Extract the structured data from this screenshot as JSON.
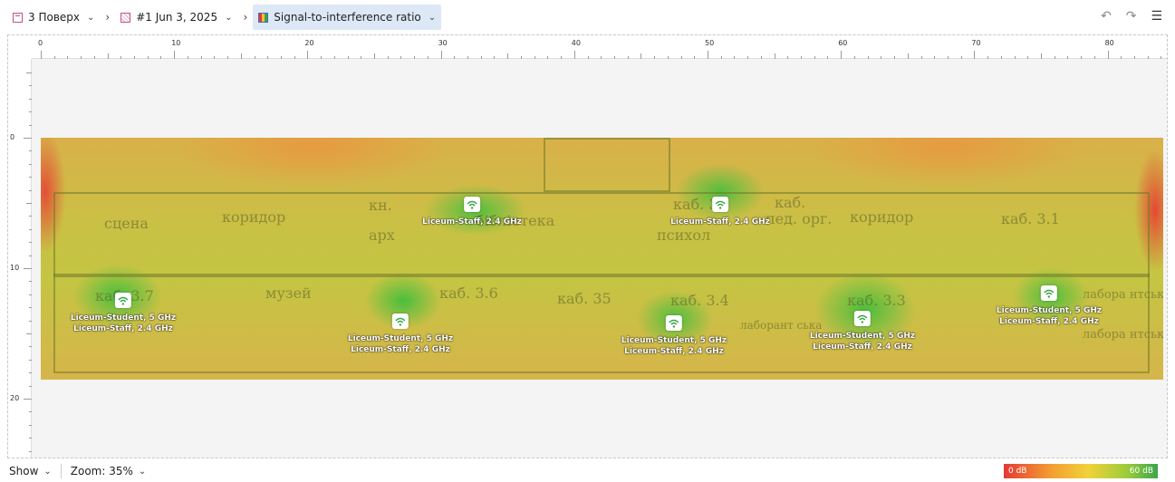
{
  "breadcrumb": {
    "floor": "3 Поверх",
    "survey": "#1 Jun 3, 2025",
    "visualization": "Signal-to-interference ratio"
  },
  "toolbar_icons": [
    "undo-icon",
    "redo-icon",
    "settings-sliders-icon"
  ],
  "ruler": {
    "top": [
      "0",
      "10",
      "20",
      "30",
      "40",
      "50",
      "60",
      "70",
      "80"
    ],
    "left": [
      "0",
      "10",
      "20"
    ],
    "units": "m"
  },
  "floor_plan": {
    "rooms": [
      "сцена",
      "коридор",
      "кн.",
      "арх",
      "бібліотека",
      "каб. 3.",
      "психол",
      "каб.",
      "пед. орг.",
      "коридор",
      "каб. 3.1",
      "каб. 3.7",
      "музей",
      "каб. 3.6",
      "каб. 35",
      "каб. 3.4",
      "лаборант ська",
      "каб. 3.3",
      "лабора нтська",
      "лабора нтська"
    ]
  },
  "access_points": [
    {
      "networks": [
        "Liceum-Student, 5 GHz",
        "Liceum-Staff, 2.4 GHz"
      ]
    },
    {
      "networks": [
        "Liceum-Staff, 2.4 GHz"
      ]
    },
    {
      "networks": [
        "Liceum-Student, 5 GHz",
        "Liceum-Staff, 2.4 GHz"
      ]
    },
    {
      "networks": [
        "Liceum-Staff, 2.4 GHz"
      ]
    },
    {
      "networks": [
        "Liceum-Student, 5 GHz",
        "Liceum-Staff, 2.4 GHz"
      ]
    },
    {
      "networks": [
        "Liceum-Student, 5 GHz",
        "Liceum-Staff, 2.4 GHz"
      ]
    },
    {
      "networks": [
        "Liceum-Student, 5 GHz",
        "Liceum-Staff, 2.4 GHz"
      ]
    }
  ],
  "bottom": {
    "show_label": "Show",
    "zoom_label": "Zoom: 35%",
    "legend_min": "0 dB",
    "legend_max": "60 dB"
  },
  "colors": {
    "active_breadcrumb_bg": "#dde8f6",
    "heat_low": "#e53935",
    "heat_mid": "#f1d23a",
    "heat_high": "#3aa64a"
  }
}
